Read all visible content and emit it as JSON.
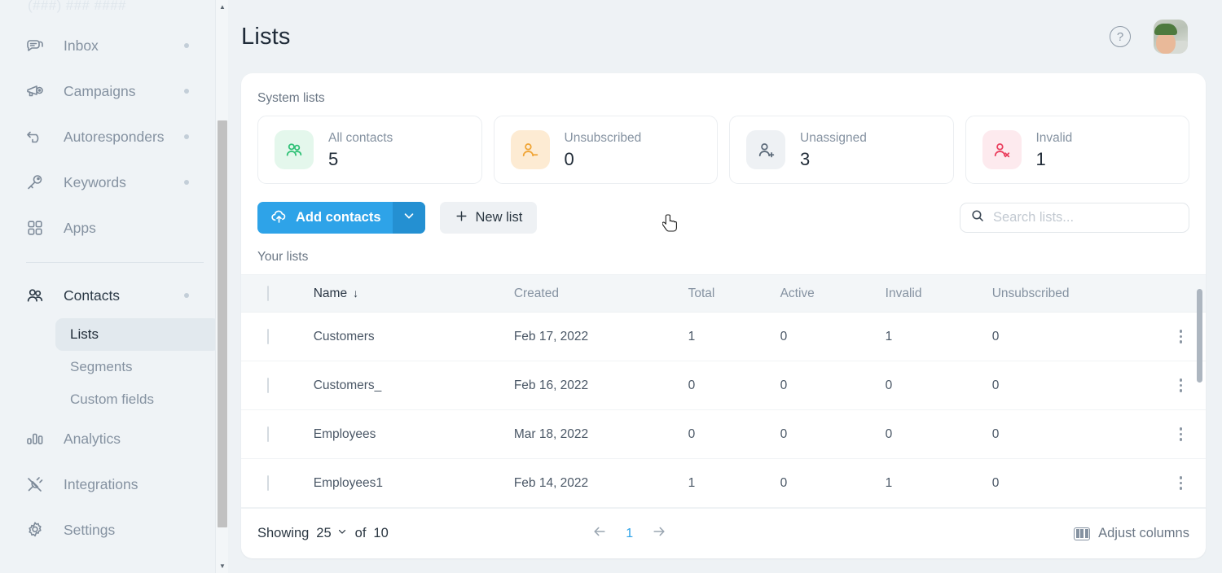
{
  "sidebar": {
    "top_text": "(###) ### ####",
    "items": [
      {
        "label": "Inbox",
        "icon": "chat-icon",
        "dot": true
      },
      {
        "label": "Campaigns",
        "icon": "megaphone-icon",
        "dot": true
      },
      {
        "label": "Autoresponders",
        "icon": "reply-icon",
        "dot": true
      },
      {
        "label": "Keywords",
        "icon": "key-icon",
        "dot": true
      },
      {
        "label": "Apps",
        "icon": "grid-icon",
        "dot": false
      }
    ],
    "contacts": {
      "label": "Contacts",
      "icon": "contacts-icon",
      "dot": true
    },
    "sub_items": [
      {
        "label": "Lists",
        "active": true
      },
      {
        "label": "Segments",
        "active": false
      },
      {
        "label": "Custom fields",
        "active": false
      }
    ],
    "bottom_items": [
      {
        "label": "Analytics",
        "icon": "analytics-icon"
      },
      {
        "label": "Integrations",
        "icon": "plug-icon"
      },
      {
        "label": "Settings",
        "icon": "gear-icon"
      }
    ]
  },
  "header": {
    "title": "Lists",
    "help_icon": "help-circle-icon",
    "avatar": "user-avatar"
  },
  "system": {
    "label": "System lists",
    "cards": [
      {
        "title": "All contacts",
        "value": "5",
        "icon": "contacts-icon",
        "color": "#2fc176",
        "bg": "#e4f7ec"
      },
      {
        "title": "Unsubscribed",
        "value": "0",
        "icon": "user-minus-icon",
        "color": "#f0a434",
        "bg": "#fdebd3"
      },
      {
        "title": "Unassigned",
        "value": "3",
        "icon": "user-plus-icon",
        "color": "#5d6b7a",
        "bg": "#eef1f4"
      },
      {
        "title": "Invalid",
        "value": "1",
        "icon": "user-x-icon",
        "color": "#ea3f5e",
        "bg": "#fdeaee"
      }
    ]
  },
  "toolbar": {
    "add_contacts_label": "Add contacts",
    "add_contacts_icon": "cloud-upload-icon",
    "add_contacts_caret": "chevron-down-icon",
    "new_list_label": "New list",
    "new_list_icon": "plus-icon",
    "search_placeholder": "Search lists...",
    "search_value": "",
    "search_icon": "search-icon",
    "accent_color": "#2ea3e8"
  },
  "table": {
    "section_label": "Your lists",
    "columns": [
      "Name",
      "Created",
      "Total",
      "Active",
      "Invalid",
      "Unsubscribed"
    ],
    "sort_column": "Name",
    "sort_direction": "desc",
    "sort_glyph": "↓",
    "rows": [
      {
        "name": "Customers",
        "created": "Feb 17, 2022",
        "total": "1",
        "active": "0",
        "invalid": "1",
        "unsubscribed": "0"
      },
      {
        "name": "Customers_",
        "created": "Feb 16, 2022",
        "total": "0",
        "active": "0",
        "invalid": "0",
        "unsubscribed": "0"
      },
      {
        "name": "Employees",
        "created": "Mar 18, 2022",
        "total": "0",
        "active": "0",
        "invalid": "0",
        "unsubscribed": "0"
      },
      {
        "name": "Employees1",
        "created": "Feb 14, 2022",
        "total": "1",
        "active": "0",
        "invalid": "1",
        "unsubscribed": "0"
      }
    ]
  },
  "footer": {
    "showing_label": "Showing",
    "per_page": "25",
    "of_label": "of",
    "total_count": "10",
    "prev_icon": "arrow-left-icon",
    "page_number": "1",
    "next_icon": "arrow-right-icon",
    "adjust_label": "Adjust columns",
    "adjust_icon": "columns-icon"
  }
}
